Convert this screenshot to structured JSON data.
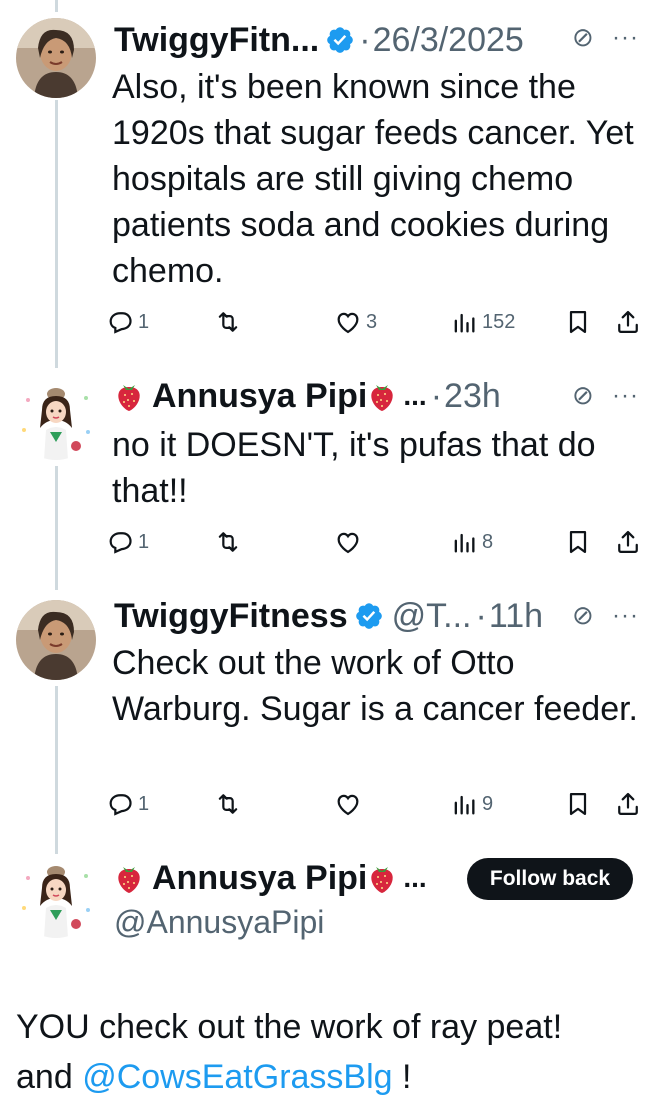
{
  "tweets": [
    {
      "name": "TwiggyFitn...",
      "verified": true,
      "date": "26/3/2025",
      "text": "Also, it's been known since the 1920s that sugar feeds cancer. Yet hospitals are still giving chemo patients soda and cookies during chemo.",
      "counts": {
        "replies": "1",
        "reposts": "",
        "likes": "3",
        "views": "152"
      }
    },
    {
      "name": "Annusya Pipi",
      "name_suffix": "...",
      "time": "23h",
      "text": "no it DOESN'T, it's pufas that do that!!",
      "counts": {
        "replies": "1",
        "reposts": "",
        "likes": "",
        "views": "8"
      }
    },
    {
      "name": "TwiggyFitness",
      "verified": true,
      "handle": "@T...",
      "time": "11h",
      "text": "Check out the work of Otto Warburg. Sugar is a cancer feeder.",
      "counts": {
        "replies": "1",
        "reposts": "",
        "likes": "",
        "views": "9"
      }
    }
  ],
  "compose": {
    "name": "Annusya Pipi",
    "name_suffix": "...",
    "follow_label": "Follow back",
    "handle": "@AnnusyaPipi",
    "reply_part1": "YOU check out the work of ray peat!",
    "reply_part2": "and",
    "reply_mention": "@CowsEatGrassBlg",
    "reply_part3": "!"
  },
  "ui": {
    "separator": "·",
    "more": "···",
    "grok": "⊘"
  },
  "colors": {
    "text": "#0f1419",
    "muted": "#536471",
    "link": "#1d9bf0",
    "verified": "#1d9bf0",
    "thread_line": "#cfd9de"
  },
  "icons": [
    "reply-icon",
    "repost-icon",
    "like-icon",
    "views-icon",
    "bookmark-icon",
    "share-icon",
    "verified-badge-icon",
    "strawberry-icon",
    "grok-icon",
    "more-icon"
  ]
}
